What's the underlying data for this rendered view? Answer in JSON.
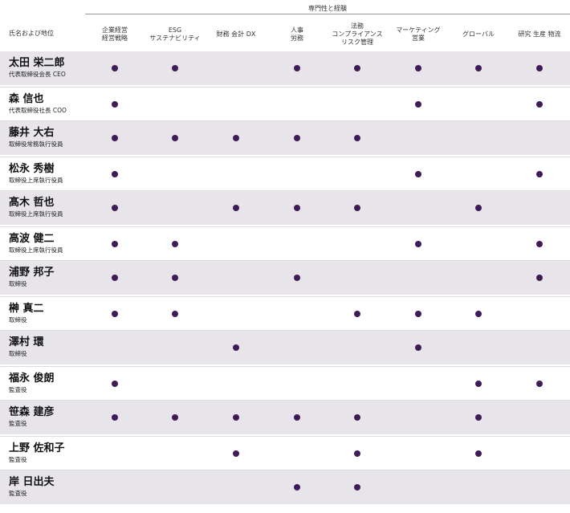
{
  "header": {
    "group_title": "専門性と経験",
    "name_column": "氏名および地位"
  },
  "columns": [
    "企業経営\n経営戦略",
    "ESG\nサステナビリティ",
    "財務 会計 DX",
    "人事\n労務",
    "法務\nコンプライアンス\nリスク管理",
    "マーケティング\n営業",
    "グローバル",
    "研究 生産 物流"
  ],
  "colors": {
    "dot": "#3f1b57",
    "row_shade": "#e7e4ea"
  },
  "rows": [
    {
      "name": "太田 栄二郎",
      "title": "代表取締役会長 CEO",
      "marks": [
        1,
        1,
        0,
        1,
        1,
        1,
        1,
        1
      ]
    },
    {
      "name": "森 信也",
      "title": "代表取締役社長 COO",
      "marks": [
        1,
        0,
        0,
        0,
        0,
        1,
        0,
        1
      ]
    },
    {
      "name": "藤井 大右",
      "title": "取締役常務執行役員",
      "marks": [
        1,
        1,
        1,
        1,
        1,
        0,
        0,
        0
      ]
    },
    {
      "name": "松永 秀樹",
      "title": "取締役上席執行役員",
      "marks": [
        1,
        0,
        0,
        0,
        0,
        1,
        0,
        1
      ]
    },
    {
      "name": "髙木 哲也",
      "title": "取締役上席執行役員",
      "marks": [
        1,
        0,
        1,
        1,
        1,
        0,
        1,
        0
      ]
    },
    {
      "name": "高波 健二",
      "title": "取締役上席執行役員",
      "marks": [
        1,
        1,
        0,
        0,
        0,
        1,
        0,
        1
      ]
    },
    {
      "name": "浦野 邦子",
      "title": "取締役",
      "marks": [
        1,
        1,
        0,
        1,
        0,
        0,
        0,
        1
      ]
    },
    {
      "name": "榊 真二",
      "title": "取締役",
      "marks": [
        1,
        1,
        0,
        0,
        1,
        1,
        1,
        0
      ]
    },
    {
      "name": "澤村 環",
      "title": "取締役",
      "marks": [
        0,
        0,
        1,
        0,
        0,
        1,
        0,
        0
      ]
    },
    {
      "name": "福永 俊朗",
      "title": "監査役",
      "marks": [
        1,
        0,
        0,
        0,
        0,
        0,
        1,
        1
      ]
    },
    {
      "name": "笹森 建彦",
      "title": "監査役",
      "marks": [
        1,
        1,
        1,
        1,
        1,
        0,
        1,
        0
      ]
    },
    {
      "name": "上野 佐和子",
      "title": "監査役",
      "marks": [
        0,
        0,
        1,
        0,
        1,
        0,
        1,
        0
      ]
    },
    {
      "name": "岸 日出夫",
      "title": "監査役",
      "marks": [
        0,
        0,
        0,
        1,
        1,
        0,
        0,
        0
      ]
    }
  ]
}
